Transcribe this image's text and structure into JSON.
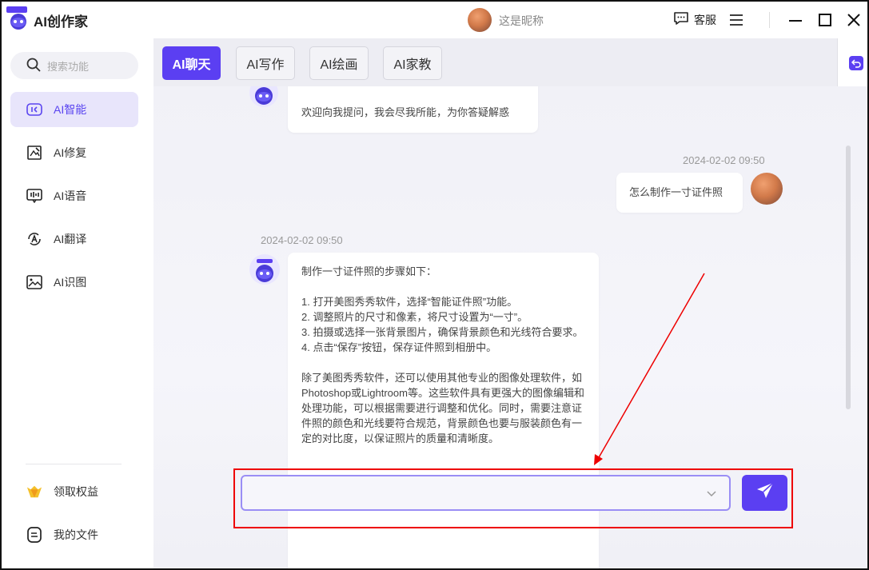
{
  "app": {
    "title": "AI创作家"
  },
  "header": {
    "nickname": "这是昵称",
    "service_label": "客服"
  },
  "sidebar": {
    "search_placeholder": "搜索功能",
    "items": [
      {
        "label": "AI智能",
        "icon": "ai-chat-icon",
        "active": true
      },
      {
        "label": "AI修复",
        "icon": "image-repair-icon",
        "active": false
      },
      {
        "label": "AI语音",
        "icon": "voice-icon",
        "active": false
      },
      {
        "label": "AI翻译",
        "icon": "translate-icon",
        "active": false
      },
      {
        "label": "AI识图",
        "icon": "image-recognition-icon",
        "active": false
      }
    ],
    "bottom_items": [
      {
        "label": "领取权益",
        "icon": "crown-icon"
      },
      {
        "label": "我的文件",
        "icon": "file-icon"
      }
    ]
  },
  "tabs": [
    {
      "label": "AI聊天",
      "active": true
    },
    {
      "label": "AI写作",
      "active": false
    },
    {
      "label": "AI绘画",
      "active": false
    },
    {
      "label": "AI家教",
      "active": false
    }
  ],
  "chat": {
    "greeting": "欢迎向我提问，我会尽我所能，为你答疑解惑",
    "user_message": {
      "timestamp": "2024-02-02 09:50",
      "text": "怎么制作一寸证件照"
    },
    "bot_reply": {
      "timestamp": "2024-02-02 09:50",
      "lines": [
        "制作一寸证件照的步骤如下：",
        "",
        "1. 打开美图秀秀软件，选择“智能证件照”功能。",
        "2. 调整照片的尺寸和像素，将尺寸设置为“一寸”。",
        "3. 拍摄或选择一张背景图片，确保背景颜色和光线符合要求。",
        "4. 点击“保存”按钮，保存证件照到相册中。",
        "",
        "除了美图秀秀软件，还可以使用其他专业的图像处理软件，如Photoshop或Lightroom等。这些软件具有更强大的图像编辑和处理功能，可以根据需要进行调整和优化。同时，需要注意证件照的颜色和光线要符合规范，背景颜色也要与服装颜色有一定的对比度，以保证照片的质量和清晰度。"
      ]
    }
  },
  "input": {
    "value": "",
    "placeholder": ""
  },
  "colors": {
    "accent": "#5b3ff2",
    "annotation": "#e00000"
  }
}
